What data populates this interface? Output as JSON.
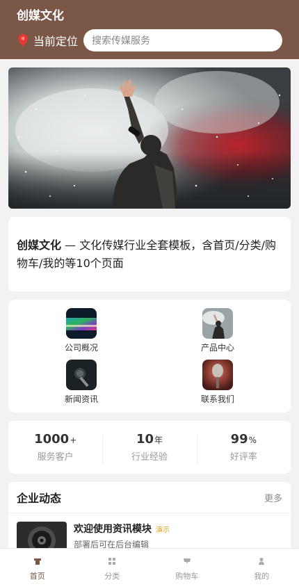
{
  "header": {
    "title": "创媒文化",
    "location_label": "当前定位",
    "location_icon": "map-pin-icon",
    "search_placeholder": "搜索传媒服务"
  },
  "intro": {
    "brand": "创媒文化",
    "text": " — 文化传媒行业全套模板，含首页/分类/购物车/我的等10个页面"
  },
  "grid": {
    "items": [
      {
        "label": "公司概况",
        "icon": "company-overview-icon"
      },
      {
        "label": "产品中心",
        "icon": "product-center-icon"
      },
      {
        "label": "新闻资讯",
        "icon": "news-icon"
      },
      {
        "label": "联系我们",
        "icon": "contact-us-icon"
      }
    ]
  },
  "stats": [
    {
      "value": "1000",
      "unit": "+",
      "label": "服务客户"
    },
    {
      "value": "10",
      "unit": "年",
      "label": "行业经验"
    },
    {
      "value": "99",
      "unit": "%",
      "label": "好评率"
    }
  ],
  "news": {
    "title": "企业动态",
    "more": "更多",
    "items": [
      {
        "headline": "欢迎使用资讯模块",
        "tag": "演示",
        "sub": "部署后可在后台编辑"
      }
    ]
  },
  "tabbar": {
    "items": [
      {
        "label": "首页",
        "icon": "home-icon",
        "active": true
      },
      {
        "label": "分类",
        "icon": "category-icon",
        "active": false
      },
      {
        "label": "购物车",
        "icon": "cart-icon",
        "active": false
      },
      {
        "label": "我的",
        "icon": "user-icon",
        "active": false
      }
    ]
  },
  "colors": {
    "brand": "#7a5747",
    "tag": "#e0a020"
  }
}
